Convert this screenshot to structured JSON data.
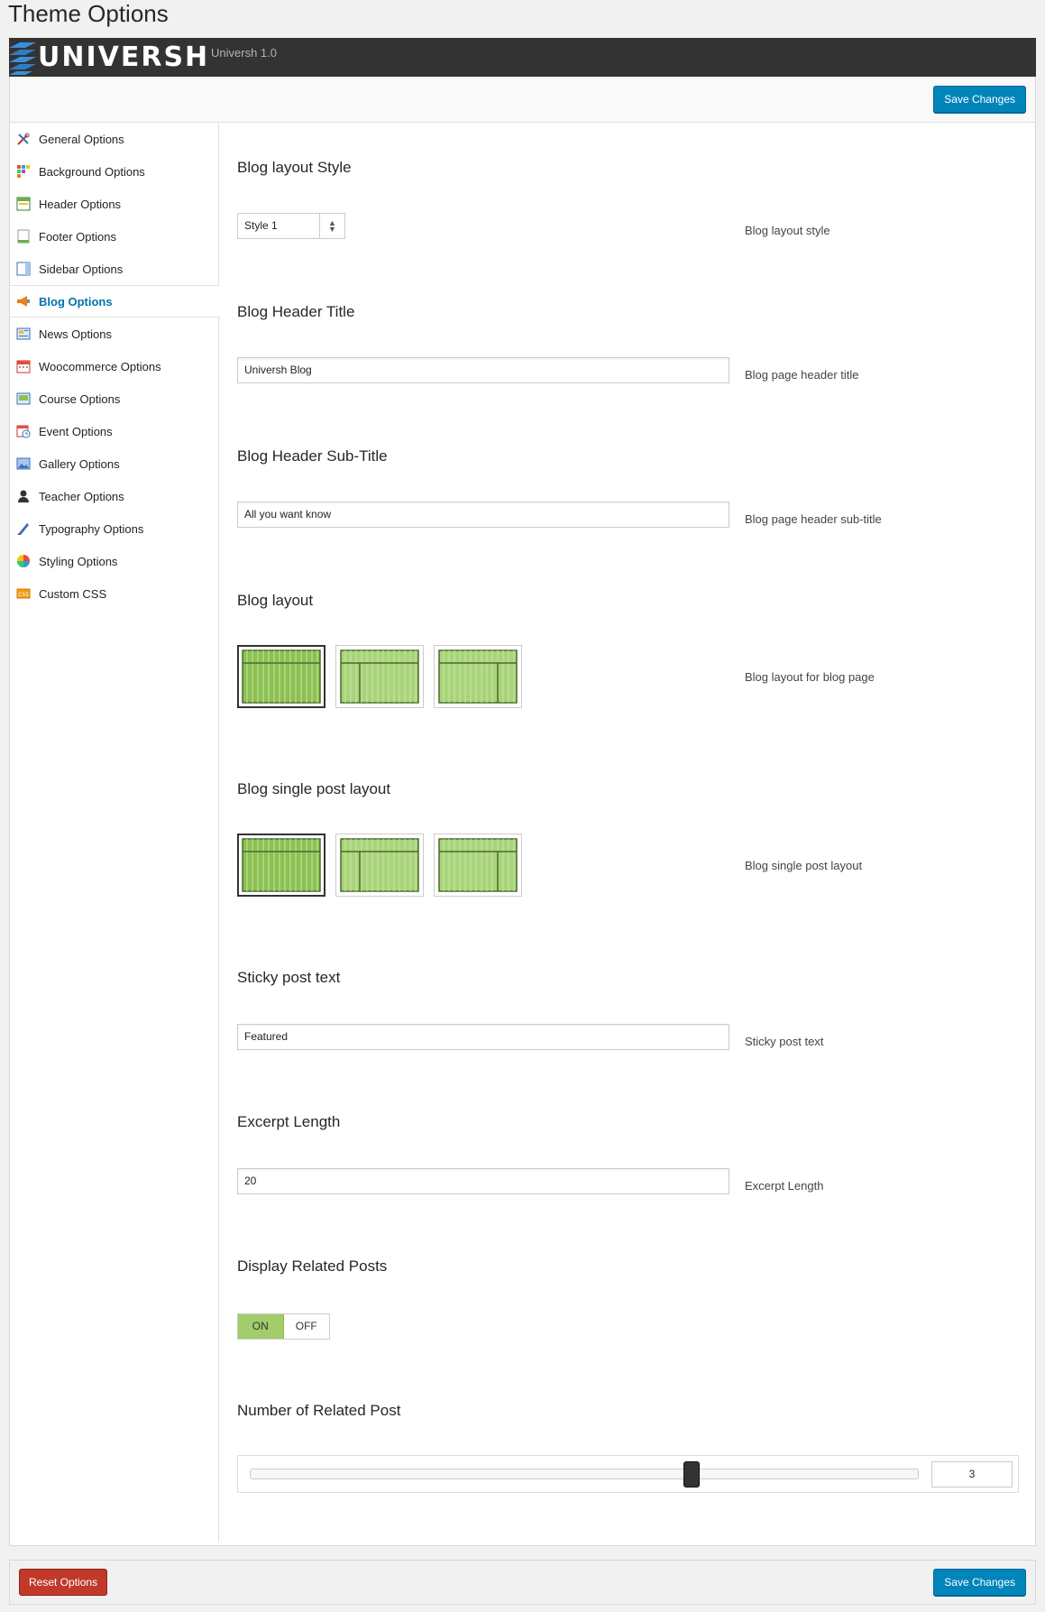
{
  "page_title": "Theme Options",
  "brand": {
    "logo_text": "UNIVERSH",
    "version": "Universh 1.0"
  },
  "actions": {
    "save_label": "Save Changes",
    "reset_label": "Reset Options"
  },
  "sidebar": {
    "items": [
      {
        "label": "General Options",
        "icon": "tools-icon"
      },
      {
        "label": "Background Options",
        "icon": "palette-icon"
      },
      {
        "label": "Header Options",
        "icon": "header-icon"
      },
      {
        "label": "Footer Options",
        "icon": "footer-icon"
      },
      {
        "label": "Sidebar Options",
        "icon": "sidebar-icon"
      },
      {
        "label": "Blog Options",
        "icon": "megaphone-icon",
        "active": true
      },
      {
        "label": "News Options",
        "icon": "news-icon"
      },
      {
        "label": "Woocommerce Options",
        "icon": "calendar-icon"
      },
      {
        "label": "Course Options",
        "icon": "course-icon"
      },
      {
        "label": "Event Options",
        "icon": "event-icon"
      },
      {
        "label": "Gallery Options",
        "icon": "gallery-icon"
      },
      {
        "label": "Teacher Options",
        "icon": "user-icon"
      },
      {
        "label": "Typography Options",
        "icon": "pen-icon"
      },
      {
        "label": "Styling Options",
        "icon": "color-wheel-icon"
      },
      {
        "label": "Custom CSS",
        "icon": "css-icon"
      }
    ]
  },
  "options": {
    "blog_layout_style": {
      "title": "Blog layout Style",
      "value": "Style 1",
      "desc": "Blog layout style"
    },
    "blog_header_title": {
      "title": "Blog Header Title",
      "value": "Universh Blog",
      "desc": "Blog page header title"
    },
    "blog_header_subtitle": {
      "title": "Blog Header Sub-Title",
      "value": "All you want know",
      "desc": "Blog page header sub-title"
    },
    "blog_layout": {
      "title": "Blog layout",
      "desc": "Blog layout for blog page",
      "choices": [
        "full-width",
        "left-sidebar",
        "right-sidebar"
      ],
      "selected": "full-width"
    },
    "blog_single_layout": {
      "title": "Blog single post layout",
      "desc": "Blog single post layout",
      "choices": [
        "full-width",
        "left-sidebar",
        "right-sidebar"
      ],
      "selected": "full-width"
    },
    "sticky_post_text": {
      "title": "Sticky post text",
      "value": "Featured",
      "desc": "Sticky post text"
    },
    "excerpt_length": {
      "title": "Excerpt Length",
      "value": "20",
      "desc": "Excerpt Length"
    },
    "related_posts": {
      "title": "Display Related Posts",
      "on_label": "ON",
      "off_label": "OFF",
      "state": "on"
    },
    "related_count": {
      "title": "Number of Related Post",
      "value": "3",
      "fraction": 0.66
    }
  },
  "colors": {
    "accent": "#0085ba",
    "danger": "#c0392b",
    "toggle_on": "#a2cd6b",
    "layout_green": "#8cc152"
  }
}
